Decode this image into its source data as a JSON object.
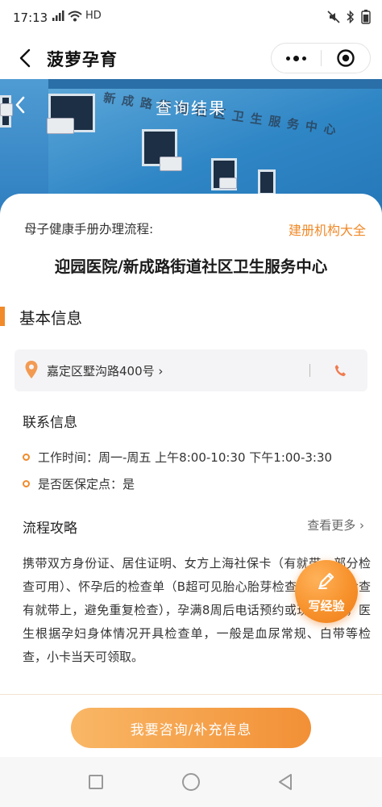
{
  "status_bar": {
    "time": "17:13",
    "network": "HD",
    "icons": [
      "signal-icon",
      "wifi-icon",
      "mute-icon",
      "bluetooth-icon",
      "battery-icon"
    ]
  },
  "nav": {
    "title": "菠萝孕育",
    "icons": [
      "back-icon",
      "more-icon",
      "close-icon"
    ]
  },
  "hero": {
    "title": "查询结果",
    "sign_text": "新成路街道社区卫生服务中心"
  },
  "card": {
    "process_label": "母子健康手册办理流程:",
    "org_link": "建册机构大全",
    "hospital_name": "迎园医院/新成路街道社区卫生服务中心"
  },
  "basic_info": {
    "title": "基本信息",
    "address": "嘉定区墅沟路400号 ›",
    "contact_title": "联系信息",
    "work_hours": "工作时间：周一-周五 上午8:00-10:30 下午1:00-3:30",
    "medical_insurance": "是否医保定点：是"
  },
  "guide": {
    "title": "流程攻略",
    "view_more": "查看更多 ›",
    "text": "携带双方身份证、居住证明、女方上海社保卡（有就带，部分检查可用）、怀孕后的检查单（B超可见胎心胎芽检查单，其他检查有就带上，避免重复检查），孕满8周后电话预约或现场挂号，医生根据孕妇身体情况开具检查单，一般是血尿常规、白带等检查，小卡当天可领取。"
  },
  "fab": {
    "label": "写经验",
    "icon": "pen-icon"
  },
  "bottom": {
    "consult_label": "我要咨询/补充信息"
  },
  "colors": {
    "accent": "#f08a2a",
    "button_gradient_start": "#f9b766",
    "button_gradient_end": "#f29036"
  }
}
